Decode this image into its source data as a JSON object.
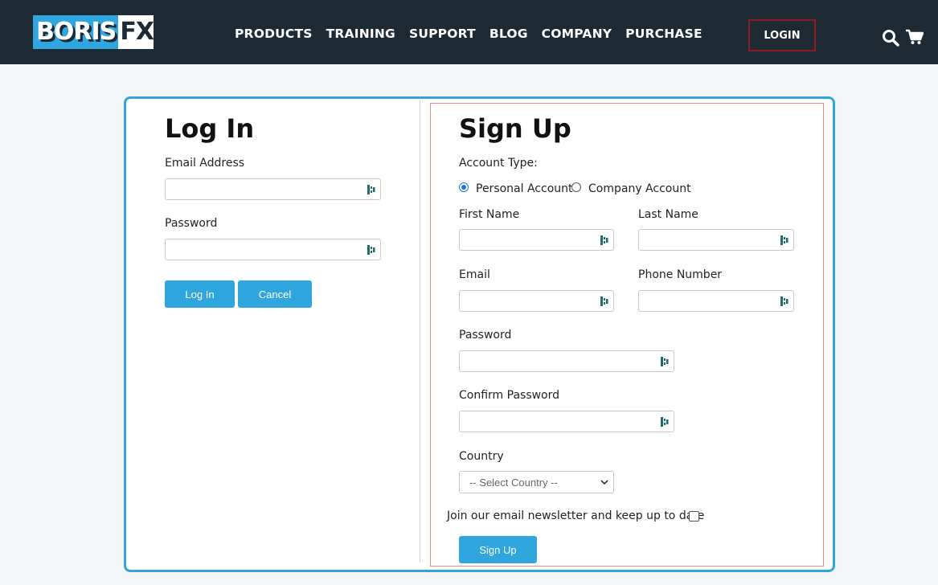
{
  "header": {
    "logo_left": "BORIS",
    "logo_right": "FX",
    "nav": [
      "PRODUCTS",
      "TRAINING",
      "SUPPORT",
      "BLOG",
      "COMPANY",
      "PURCHASE"
    ],
    "login_label": "LOGIN",
    "icons": [
      "search-icon",
      "cart-icon"
    ]
  },
  "login": {
    "title": "Log In",
    "email_label": "Email Address",
    "password_label": "Password",
    "login_button": "Log In",
    "cancel_button": "Cancel"
  },
  "signup": {
    "title": "Sign Up",
    "account_type_label": "Account Type:",
    "account_types": [
      "Personal Account",
      "Company Account"
    ],
    "selected_account_type": "Personal Account",
    "first_name_label": "First Name",
    "last_name_label": "Last Name",
    "email_label": "Email",
    "phone_label": "Phone Number",
    "password_label": "Password",
    "confirm_password_label": "Confirm Password",
    "country_label": "Country",
    "country_placeholder": "-- Select Country --",
    "newsletter_label": "Join our email newsletter and keep up to date",
    "signup_button": "Sign Up"
  },
  "colors": {
    "header_bg": "#1d2933",
    "accent": "#2fa6dd",
    "login_border": "#8e1b24",
    "highlight_frame": "#f0888c"
  }
}
